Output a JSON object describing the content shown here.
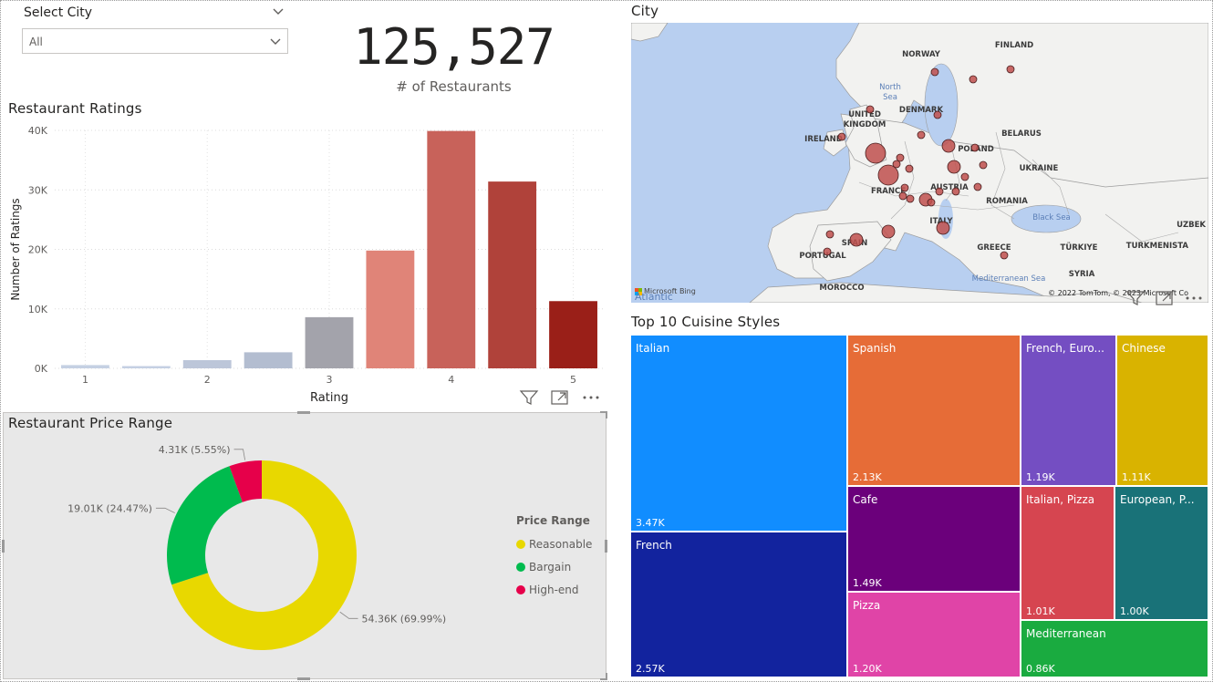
{
  "slicer": {
    "title": "Select City",
    "selected": "All",
    "icon": "chevron-down-icon"
  },
  "card": {
    "value": "125,527",
    "label": "# of Restaurants"
  },
  "bar_visual": {
    "title": "Restaurant Ratings",
    "icons": [
      "filter-icon",
      "focus-mode-icon",
      "more-options-icon"
    ]
  },
  "donut_visual": {
    "title": "Restaurant Price Range",
    "legend_title": "Price Range"
  },
  "map_visual": {
    "title": "City",
    "copyright": "© 2022 TomTom, © 2023 Microsoft Co",
    "bing_label": "Microsoft Bing",
    "atlantic_label": "Atlantic",
    "labels": [
      {
        "text": "FINLAND",
        "kind": "country"
      },
      {
        "text": "NORWAY",
        "kind": "country"
      },
      {
        "text": "North",
        "kind": "sea"
      },
      {
        "text": "Sea",
        "kind": "sea"
      },
      {
        "text": "UNITED",
        "kind": "country"
      },
      {
        "text": "KINGDOM",
        "kind": "country"
      },
      {
        "text": "DENMARK",
        "kind": "country"
      },
      {
        "text": "IRELAND",
        "kind": "country"
      },
      {
        "text": "BELARUS",
        "kind": "country"
      },
      {
        "text": "POLAND",
        "kind": "country"
      },
      {
        "text": "UKRAINE",
        "kind": "country"
      },
      {
        "text": "FRANCE",
        "kind": "country"
      },
      {
        "text": "AUSTRIA",
        "kind": "country"
      },
      {
        "text": "ROMANIA",
        "kind": "country"
      },
      {
        "text": "Black Sea",
        "kind": "sea"
      },
      {
        "text": "ITALY",
        "kind": "country"
      },
      {
        "text": "SPAIN",
        "kind": "country"
      },
      {
        "text": "PORTUGAL",
        "kind": "country"
      },
      {
        "text": "GREECE",
        "kind": "country"
      },
      {
        "text": "TÜRKIYE",
        "kind": "country"
      },
      {
        "text": "UZBEK",
        "kind": "country"
      },
      {
        "text": "TURKMENISTA",
        "kind": "country"
      },
      {
        "text": "SYRIA",
        "kind": "country"
      },
      {
        "text": "Mediterranean Sea",
        "kind": "sea"
      },
      {
        "text": "MOROCCO",
        "kind": "country"
      }
    ],
    "bubbles": [
      {
        "city": "London",
        "size": "large"
      },
      {
        "city": "Paris",
        "size": "large"
      },
      {
        "city": "Madrid",
        "size": "medium"
      },
      {
        "city": "Barcelona",
        "size": "medium"
      },
      {
        "city": "Rome",
        "size": "medium"
      },
      {
        "city": "Milan",
        "size": "medium"
      },
      {
        "city": "Berlin",
        "size": "medium"
      },
      {
        "city": "Prague",
        "size": "medium"
      },
      {
        "city": "Vienna",
        "size": "small"
      },
      {
        "city": "Amsterdam",
        "size": "small"
      },
      {
        "city": "Brussels",
        "size": "small"
      },
      {
        "city": "Munich",
        "size": "small"
      },
      {
        "city": "Hamburg",
        "size": "small"
      },
      {
        "city": "Copenhagen",
        "size": "small"
      },
      {
        "city": "Stockholm",
        "size": "small"
      },
      {
        "city": "Oslo",
        "size": "small"
      },
      {
        "city": "Helsinki",
        "size": "small"
      },
      {
        "city": "Warsaw",
        "size": "small"
      },
      {
        "city": "Krakow",
        "size": "small"
      },
      {
        "city": "Budapest",
        "size": "small"
      },
      {
        "city": "Bratislava",
        "size": "small"
      },
      {
        "city": "Zurich",
        "size": "small"
      },
      {
        "city": "Geneva",
        "size": "small"
      },
      {
        "city": "Lyon",
        "size": "small"
      },
      {
        "city": "Luxembourg",
        "size": "small"
      },
      {
        "city": "Dublin",
        "size": "small"
      },
      {
        "city": "Edinburgh",
        "size": "small"
      },
      {
        "city": "Lisbon",
        "size": "small"
      },
      {
        "city": "Porto",
        "size": "small"
      },
      {
        "city": "Athens",
        "size": "small"
      },
      {
        "city": "Ljubljana",
        "size": "small"
      }
    ]
  },
  "tree_visual": {
    "title": "Top 10 Cuisine Styles"
  },
  "colors": {
    "reasonable": "#e8d800",
    "bargain": "#00bb4e",
    "high_end": "#e6004a",
    "map_land": "#f2f2f0",
    "map_water": "#b8cff0",
    "bubble": "#c0504d"
  },
  "chart_data": [
    {
      "type": "bar",
      "title": "Restaurant Ratings",
      "xlabel": "Rating",
      "ylabel": "Number of Ratings",
      "categories": [
        "1",
        "1.5",
        "2",
        "2.5",
        "3",
        "3.5",
        "4",
        "4.5",
        "5"
      ],
      "x_tick_labels": [
        "1",
        "2",
        "3",
        "4",
        "5"
      ],
      "values": [
        550,
        380,
        1380,
        2700,
        8600,
        19800,
        39900,
        31400,
        11300
      ],
      "bar_colors": [
        "#c5d0e3",
        "#c5d0e3",
        "#bcc6d9",
        "#b3bdd0",
        "#a3a3ab",
        "#e08478",
        "#c8625a",
        "#b0423a",
        "#9a1f18"
      ],
      "y_ticks": [
        "0K",
        "10K",
        "20K",
        "30K",
        "40K"
      ],
      "ylim": [
        0,
        40000
      ],
      "grid": true
    },
    {
      "type": "pie",
      "subtype": "donut",
      "title": "Restaurant Price Range",
      "slices": [
        {
          "name": "Reasonable",
          "value": 54360,
          "label": "54.36K (69.99%)",
          "color": "#e8d800"
        },
        {
          "name": "Bargain",
          "value": 19010,
          "label": "19.01K (24.47%)",
          "color": "#00bb4e"
        },
        {
          "name": "High-end",
          "value": 4310,
          "label": "4.31K (5.55%)",
          "color": "#e6004a"
        }
      ],
      "legend_position": "right"
    },
    {
      "type": "treemap",
      "title": "Top 10 Cuisine Styles",
      "items": [
        {
          "name": "Italian",
          "value": 3470,
          "label": "3.47K",
          "color": "#118dff"
        },
        {
          "name": "French",
          "value": 2570,
          "label": "2.57K",
          "color": "#12239e"
        },
        {
          "name": "Spanish",
          "value": 2130,
          "label": "2.13K",
          "color": "#e66c37"
        },
        {
          "name": "Cafe",
          "value": 1490,
          "label": "1.49K",
          "color": "#6b007b"
        },
        {
          "name": "Pizza",
          "value": 1200,
          "label": "1.20K",
          "color": "#e044a7"
        },
        {
          "name": "French, Euro...",
          "value": 1190,
          "label": "1.19K",
          "color": "#744ec2"
        },
        {
          "name": "Chinese",
          "value": 1110,
          "label": "1.11K",
          "color": "#d9b300"
        },
        {
          "name": "Italian, Pizza",
          "value": 1010,
          "label": "1.01K",
          "color": "#d64550"
        },
        {
          "name": "European, P...",
          "value": 1000,
          "label": "1.00K",
          "color": "#197278"
        },
        {
          "name": "Mediterranean",
          "value": 860,
          "label": "0.86K",
          "color": "#1aab40"
        }
      ]
    }
  ]
}
